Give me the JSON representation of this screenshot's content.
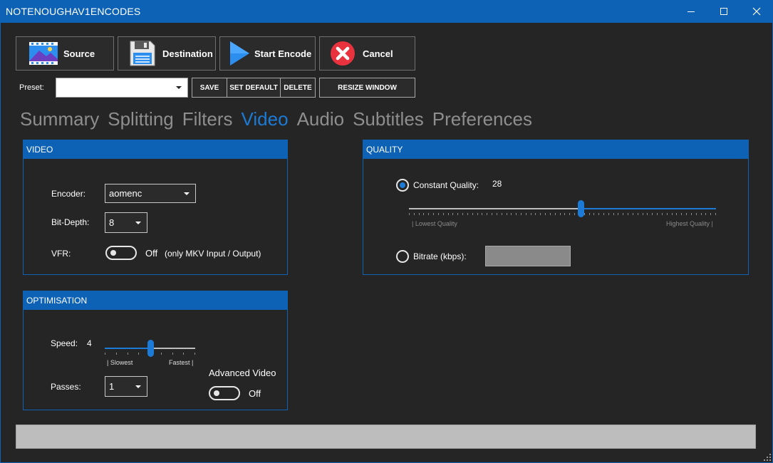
{
  "window": {
    "title": "NOTENOUGHAV1ENCODES",
    "minimize_icon": "minimize-icon",
    "maximize_icon": "maximize-icon",
    "close_icon": "close-icon"
  },
  "toolbar": {
    "source_label": "Source",
    "destination_label": "Destination",
    "start_label": "Start Encode",
    "cancel_label": "Cancel"
  },
  "preset": {
    "label": "Preset:",
    "value": "",
    "save_label": "SAVE",
    "set_default_label": "SET DEFAULT",
    "delete_label": "DELETE",
    "resize_label": "RESIZE WINDOW"
  },
  "tabs": [
    {
      "label": "Summary",
      "active": false
    },
    {
      "label": "Splitting",
      "active": false
    },
    {
      "label": "Filters",
      "active": false
    },
    {
      "label": "Video",
      "active": true
    },
    {
      "label": "Audio",
      "active": false
    },
    {
      "label": "Subtitles",
      "active": false
    },
    {
      "label": "Preferences",
      "active": false
    }
  ],
  "video_group": {
    "header": "VIDEO",
    "encoder_label": "Encoder:",
    "encoder_value": "aomenc",
    "bitdepth_label": "Bit-Depth:",
    "bitdepth_value": "8",
    "vfr_label": "VFR:",
    "vfr_state": "Off",
    "vfr_note": "(only MKV Input / Output)"
  },
  "optimisation_group": {
    "header": "OPTIMISATION",
    "speed_label": "Speed:",
    "speed_value": "4",
    "speed_min_label": "| Slowest",
    "speed_max_label": "Fastest |",
    "speed_fraction": 0.5,
    "passes_label": "Passes:",
    "passes_value": "1",
    "advanced_label": "Advanced Video",
    "advanced_state": "Off"
  },
  "quality_group": {
    "header": "QUALITY",
    "cq_label": "Constant Quality:",
    "cq_value": "28",
    "cq_selected": true,
    "cq_fraction": 0.56,
    "min_label": "| Lowest Quality",
    "max_label": "Highest Quality |",
    "bitrate_label": "Bitrate (kbps):",
    "bitrate_value": ""
  },
  "progress": {
    "value": 0
  },
  "colors": {
    "accent": "#0d62b6",
    "active_tab": "#1c7bd6",
    "background": "#252525"
  }
}
